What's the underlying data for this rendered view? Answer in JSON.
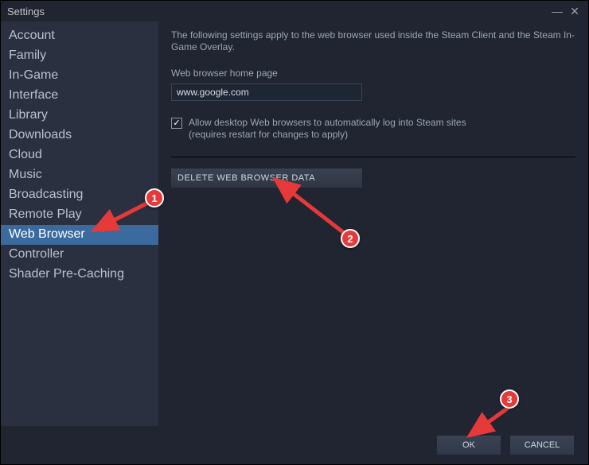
{
  "window": {
    "title": "Settings"
  },
  "sidebar": {
    "items": [
      {
        "label": "Account"
      },
      {
        "label": "Family"
      },
      {
        "label": "In-Game"
      },
      {
        "label": "Interface"
      },
      {
        "label": "Library"
      },
      {
        "label": "Downloads"
      },
      {
        "label": "Cloud"
      },
      {
        "label": "Music"
      },
      {
        "label": "Broadcasting"
      },
      {
        "label": "Remote Play"
      },
      {
        "label": "Web Browser"
      },
      {
        "label": "Controller"
      },
      {
        "label": "Shader Pre-Caching"
      }
    ],
    "selected_index": 10
  },
  "main": {
    "description": "The following settings apply to the web browser used inside the Steam Client and the Steam In-Game Overlay.",
    "homepage_label": "Web browser home page",
    "homepage_value": "www.google.com",
    "checkbox_checked": true,
    "checkbox_text_line1": "Allow desktop Web browsers to automatically log into Steam sites",
    "checkbox_text_line2": "(requires restart for changes to apply)",
    "delete_button": "DELETE WEB BROWSER DATA"
  },
  "footer": {
    "ok": "OK",
    "cancel": "CANCEL"
  },
  "annotations": {
    "badge1": "1",
    "badge2": "2",
    "badge3": "3"
  }
}
